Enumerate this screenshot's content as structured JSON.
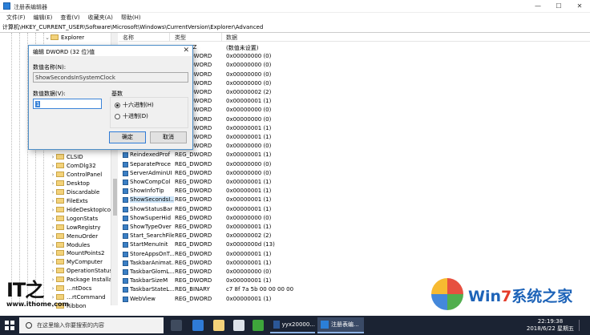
{
  "window": {
    "title": "注册表编辑器",
    "controls": {
      "minimize": "—",
      "maximize": "☐",
      "close": "✕"
    }
  },
  "menu": [
    "文件(F)",
    "编辑(E)",
    "查看(V)",
    "收藏夹(A)",
    "帮助(H)"
  ],
  "address": "计算机\\HKEY_CURRENT_USER\\Software\\Microsoft\\Windows\\CurrentVersion\\Explorer\\Advanced",
  "tree": {
    "top_item": "Explorer",
    "items": [
      "CLSID",
      "ComDlg32",
      "ControlPanel",
      "Desktop",
      "Discardable",
      "FileExts",
      "HideDesktopIcon",
      "LogonStats",
      "LowRegistry",
      "MenuOrder",
      "Modules",
      "MountPoints2",
      "MyComputer",
      "OperationStatusM",
      "Package Installati",
      "…ntDocs",
      "…rtCommand",
      "Ribbon"
    ]
  },
  "columns": {
    "name": "名称",
    "type": "类型",
    "data": "数据"
  },
  "values": [
    {
      "name": "(默认)",
      "type": "REG_SZ",
      "data": "(数值未设置)",
      "kind": "str"
    },
    {
      "name": "",
      "type": "REG_DWORD",
      "data": "0x00000000 (0)",
      "kind": "dword"
    },
    {
      "name": "",
      "type": "REG_DWORD",
      "data": "0x00000000 (0)",
      "kind": "dword"
    },
    {
      "name": "",
      "type": "REG_DWORD",
      "data": "0x00000000 (0)",
      "kind": "dword"
    },
    {
      "name": "",
      "type": "REG_DWORD",
      "data": "0x00000000 (0)",
      "kind": "dword"
    },
    {
      "name": "",
      "type": "REG_DWORD",
      "data": "0x00000002 (2)",
      "kind": "dword"
    },
    {
      "name": "",
      "type": "REG_DWORD",
      "data": "0x00000001 (1)",
      "kind": "dword"
    },
    {
      "name": "",
      "type": "REG_DWORD",
      "data": "0x00000000 (0)",
      "kind": "dword"
    },
    {
      "name": "",
      "type": "REG_DWORD",
      "data": "0x00000000 (0)",
      "kind": "dword"
    },
    {
      "name": "",
      "type": "REG_DWORD",
      "data": "0x00000001 (1)",
      "kind": "dword"
    },
    {
      "name": "",
      "type": "REG_DWORD",
      "data": "0x00000001 (1)",
      "kind": "dword"
    },
    {
      "name": "",
      "type": "REG_DWORD",
      "data": "0x00000000 (0)",
      "kind": "dword"
    },
    {
      "name": "ReindexedProf",
      "type": "REG_DWORD",
      "data": "0x00000001 (1)",
      "kind": "dword"
    },
    {
      "name": "SeparateProce",
      "type": "REG_DWORD",
      "data": "0x00000000 (0)",
      "kind": "dword"
    },
    {
      "name": "ServerAdminUI",
      "type": "REG_DWORD",
      "data": "0x00000000 (0)",
      "kind": "dword"
    },
    {
      "name": "ShowCompCol",
      "type": "REG_DWORD",
      "data": "0x00000001 (1)",
      "kind": "dword"
    },
    {
      "name": "ShowInfoTip",
      "type": "REG_DWORD",
      "data": "0x00000001 (1)",
      "kind": "dword"
    },
    {
      "name": "ShowSecondsI...",
      "type": "REG_DWORD",
      "data": "0x00000001 (1)",
      "kind": "dword",
      "selected": true
    },
    {
      "name": "ShowStatusBar",
      "type": "REG_DWORD",
      "data": "0x00000001 (1)",
      "kind": "dword"
    },
    {
      "name": "ShowSuperHid",
      "type": "REG_DWORD",
      "data": "0x00000000 (0)",
      "kind": "dword"
    },
    {
      "name": "ShowTypeOver",
      "type": "REG_DWORD",
      "data": "0x00000001 (1)",
      "kind": "dword"
    },
    {
      "name": "Start_SearchFiles",
      "type": "REG_DWORD",
      "data": "0x00000002 (2)",
      "kind": "dword"
    },
    {
      "name": "StartMenuInit",
      "type": "REG_DWORD",
      "data": "0x0000000d (13)",
      "kind": "dword"
    },
    {
      "name": "StoreAppsOnT...",
      "type": "REG_DWORD",
      "data": "0x00000001 (1)",
      "kind": "dword"
    },
    {
      "name": "TaskbarAnimat...",
      "type": "REG_DWORD",
      "data": "0x00000001 (1)",
      "kind": "dword"
    },
    {
      "name": "TaskbarGlomL...",
      "type": "REG_DWORD",
      "data": "0x00000000 (0)",
      "kind": "dword"
    },
    {
      "name": "TaskbarSizeM",
      "type": "REG_DWORD",
      "data": "0x00000001 (1)",
      "kind": "dword"
    },
    {
      "name": "TaskbarStateL...",
      "type": "REG_BINARY",
      "data": "c7 8f 7a 5b 00 00 00 00",
      "kind": "dword"
    },
    {
      "name": "WebView",
      "type": "REG_DWORD",
      "data": "0x00000001 (1)",
      "kind": "dword"
    }
  ],
  "dialog": {
    "title": "编辑 DWORD (32 位)值",
    "close": "✕",
    "name_label": "数值名称(N):",
    "name_value": "ShowSecondsInSystemClock",
    "data_label": "数值数据(V):",
    "data_value": "1",
    "base_label": "基数",
    "radio_hex": "十六进制(H)",
    "radio_dec": "十进制(D)",
    "ok": "确定",
    "cancel": "取消"
  },
  "watermarks": {
    "ithome_url": "www.ithome.com",
    "win7_a": "Win",
    "win7_b": "7",
    "win7_c": "系统之家"
  },
  "taskbar": {
    "search_placeholder": "在这里输入你要搜索的内容",
    "task_word": "yyx20000...",
    "task_regedit": "注册表编...",
    "time": "22:19:38",
    "date": "2018/6/22 星期五"
  }
}
